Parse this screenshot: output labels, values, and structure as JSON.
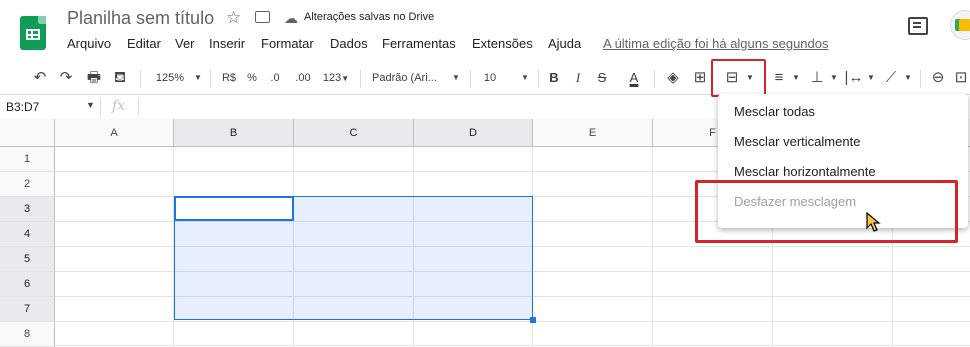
{
  "titlebar": {
    "title": "Planilha sem título",
    "star_icon": "☆",
    "saved_status": "Alterações salvas no Drive",
    "menus": [
      "Arquivo",
      "Editar",
      "Ver",
      "Inserir",
      "Formatar",
      "Dados",
      "Ferramentas",
      "Extensões",
      "Ajuda"
    ],
    "last_edit": "A última edição foi há alguns segundos"
  },
  "toolbar": {
    "undo": "↶",
    "redo": "↷",
    "print": "🖶",
    "paint": "⛾",
    "zoom": "125%",
    "currency": "R$",
    "percent": "%",
    "dec_decrease": ".0",
    "dec_increase": ".00",
    "more_formats": "123",
    "font": "Padrão (Ari...",
    "font_size": "10",
    "bold": "B",
    "italic": "I",
    "strike": "S",
    "text_color": "A",
    "fill": "◈",
    "borders": "⊞",
    "merge": "⊟",
    "halign": "≡",
    "valign": "⊥",
    "wrap": "|↔",
    "rotate": "⟋",
    "link": "⊖",
    "comment": "⊡"
  },
  "formula_bar": {
    "name_box": "B3:D7",
    "fx": "fx"
  },
  "grid": {
    "columns": [
      "A",
      "B",
      "C",
      "D",
      "E",
      "F"
    ],
    "rows": [
      "1",
      "2",
      "3",
      "4",
      "5",
      "6",
      "7",
      "8"
    ]
  },
  "merge_menu": {
    "items": [
      "Mesclar todas",
      "Mesclar verticalmente",
      "Mesclar horizontalmente",
      "Desfazer mesclagem"
    ]
  },
  "colors": {
    "brand_green": "#0f9d58",
    "selection_blue": "#1a73e8",
    "highlight_red": "#d6252a"
  }
}
